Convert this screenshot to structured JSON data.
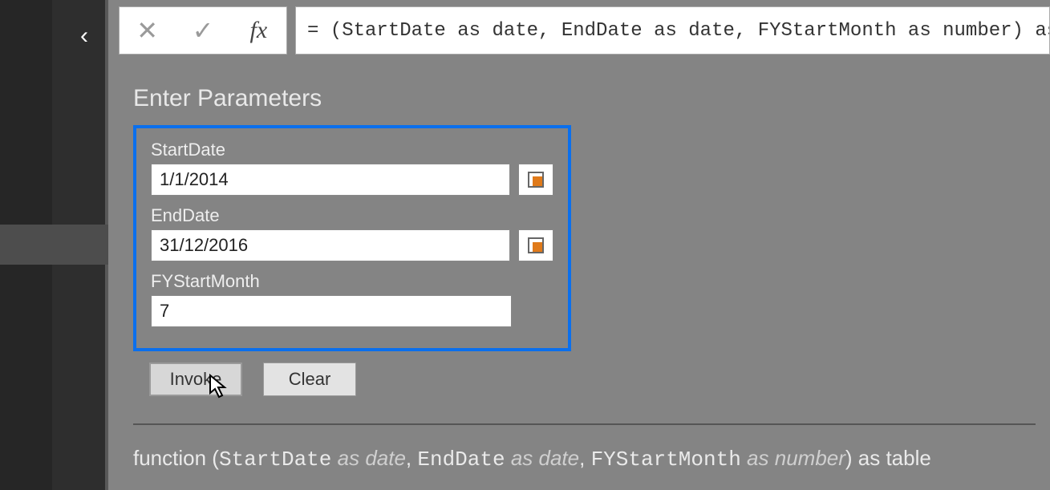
{
  "formulaBar": {
    "expression": "= (StartDate as date, EndDate as date, FYStartMonth as number) as table"
  },
  "heading": "Enter Parameters",
  "params": {
    "startDate": {
      "label": "StartDate",
      "value": "1/1/2014"
    },
    "endDate": {
      "label": "EndDate",
      "value": "31/12/2016"
    },
    "fyStartMonth": {
      "label": "FYStartMonth",
      "value": "7"
    }
  },
  "buttons": {
    "invoke": "Invoke",
    "clear": "Clear"
  },
  "signature": {
    "prefix": "function (",
    "p1name": "StartDate",
    "as1": " as ",
    "t1": "date",
    "sep1": ", ",
    "p2name": "EndDate",
    "as2": " as ",
    "t2": "date",
    "sep2": ", ",
    "p3name": "FYStartMonth",
    "as3": " as ",
    "t3": "number",
    "suffix": ") as table"
  }
}
